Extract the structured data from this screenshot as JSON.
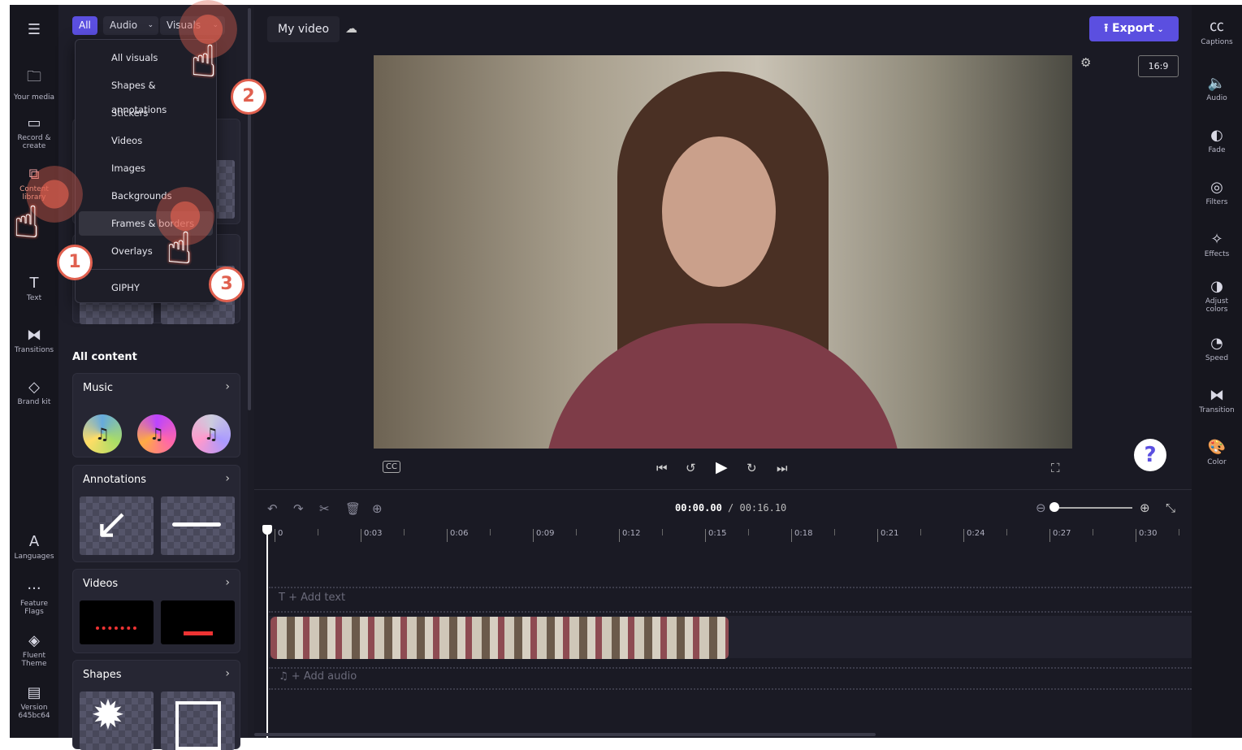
{
  "left_rail": {
    "items": [
      {
        "label": "Your media",
        "icon": "folder-icon"
      },
      {
        "label": "Record & create",
        "icon": "camera-icon"
      },
      {
        "label": "Content library",
        "icon": "content-library-icon"
      },
      {
        "label": "Text",
        "icon": "text-icon"
      },
      {
        "label": "Transitions",
        "icon": "transitions-icon"
      },
      {
        "label": "Brand kit",
        "icon": "brand-kit-icon"
      }
    ],
    "bottom_items": [
      {
        "label": "Languages",
        "icon": "languages-icon"
      },
      {
        "label": "Feature Flags",
        "icon": "more-icon"
      },
      {
        "label": "Fluent Theme",
        "icon": "paint-bucket-icon"
      },
      {
        "label": "Version 645bc64",
        "icon": "archive-icon"
      }
    ]
  },
  "filters": {
    "all": "All",
    "audio": "Audio",
    "visuals": "Visuals"
  },
  "visuals_menu": {
    "items": [
      "All visuals",
      "Shapes & annotations",
      "Stickers",
      "Videos",
      "Images",
      "Backgrounds",
      "Frames & borders",
      "Overlays",
      "GIPHY"
    ],
    "selected": "Frames & borders"
  },
  "library": {
    "heading": "All content",
    "cards": [
      {
        "title": "Music"
      },
      {
        "title": "Annotations"
      },
      {
        "title": "Videos"
      },
      {
        "title": "Shapes"
      }
    ]
  },
  "header": {
    "project_name": "My video",
    "export_label": "Export",
    "aspect_ratio": "16:9"
  },
  "accent_color": "#5b4fe0",
  "timeline": {
    "current_time": "00:00.00",
    "total_time": "/ 00:16.10",
    "ticks": [
      "0",
      "0:03",
      "0:06",
      "0:09",
      "0:12",
      "0:15",
      "0:18",
      "0:21",
      "0:24",
      "0:27",
      "0:30"
    ],
    "add_text": "+ Add text",
    "add_audio": "+ Add audio"
  },
  "right_rail": {
    "items": [
      "Captions",
      "Audio",
      "Fade",
      "Filters",
      "Effects",
      "Adjust colors",
      "Speed",
      "Transition",
      "Color"
    ]
  },
  "tutorial_steps": [
    "1",
    "2",
    "3"
  ],
  "help_label": "?"
}
